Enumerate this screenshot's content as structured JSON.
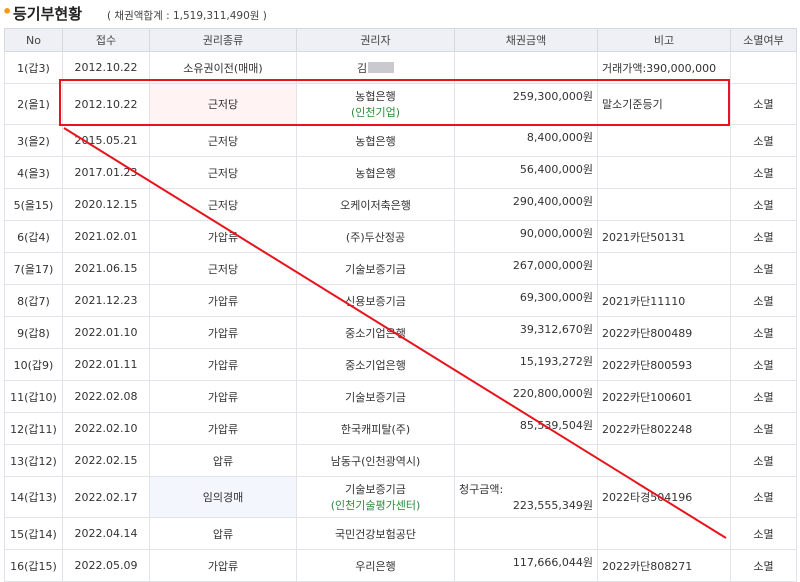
{
  "header": {
    "bullet": "•",
    "title": "등기부현황",
    "subtitle": "( 채권액합계 : 1,519,311,490원 )"
  },
  "columns": [
    "No",
    "접수",
    "권리종류",
    "권리자",
    "채권금액",
    "비고",
    "소멸여부"
  ],
  "rows": [
    {
      "no": "1(갑3)",
      "date": "2012.10.22",
      "type": "소유권이전(매매)",
      "holder": "김",
      "holder_sub": "",
      "amount": "",
      "note": "거래가액:390,000,000",
      "extinct": ""
    },
    {
      "no": "2(을1)",
      "date": "2012.10.22",
      "type": "근저당",
      "holder": "농협은행",
      "holder_sub": "(인천기업)",
      "amount": "259,300,000원",
      "note": "말소기준등기",
      "extinct": "소멸"
    },
    {
      "no": "3(을2)",
      "date": "2015.05.21",
      "type": "근저당",
      "holder": "농협은행",
      "holder_sub": "",
      "amount": "8,400,000원",
      "note": "",
      "extinct": "소멸"
    },
    {
      "no": "4(을3)",
      "date": "2017.01.23",
      "type": "근저당",
      "holder": "농협은행",
      "holder_sub": "",
      "amount": "56,400,000원",
      "note": "",
      "extinct": "소멸"
    },
    {
      "no": "5(을15)",
      "date": "2020.12.15",
      "type": "근저당",
      "holder": "오케이저축은행",
      "holder_sub": "",
      "amount": "290,400,000원",
      "note": "",
      "extinct": "소멸"
    },
    {
      "no": "6(갑4)",
      "date": "2021.02.01",
      "type": "가압류",
      "holder": "(주)두산정공",
      "holder_sub": "",
      "amount": "90,000,000원",
      "note": "2021카단50131",
      "extinct": "소멸"
    },
    {
      "no": "7(을17)",
      "date": "2021.06.15",
      "type": "근저당",
      "holder": "기술보증기금",
      "holder_sub": "",
      "amount": "267,000,000원",
      "note": "",
      "extinct": "소멸"
    },
    {
      "no": "8(갑7)",
      "date": "2021.12.23",
      "type": "가압류",
      "holder": "신용보증기금",
      "holder_sub": "",
      "amount": "69,300,000원",
      "note": "2021카단11110",
      "extinct": "소멸"
    },
    {
      "no": "9(갑8)",
      "date": "2022.01.10",
      "type": "가압류",
      "holder": "중소기업은행",
      "holder_sub": "",
      "amount": "39,312,670원",
      "note": "2022카단800489",
      "extinct": "소멸"
    },
    {
      "no": "10(갑9)",
      "date": "2022.01.11",
      "type": "가압류",
      "holder": "중소기업은행",
      "holder_sub": "",
      "amount": "15,193,272원",
      "note": "2022카단800593",
      "extinct": "소멸"
    },
    {
      "no": "11(갑10)",
      "date": "2022.02.08",
      "type": "가압류",
      "holder": "기술보증기금",
      "holder_sub": "",
      "amount": "220,800,000원",
      "note": "2022카단100601",
      "extinct": "소멸"
    },
    {
      "no": "12(갑11)",
      "date": "2022.02.10",
      "type": "가압류",
      "holder": "한국캐피탈(주)",
      "holder_sub": "",
      "amount": "85,539,504원",
      "note": "2022카단802248",
      "extinct": "소멸"
    },
    {
      "no": "13(갑12)",
      "date": "2022.02.15",
      "type": "압류",
      "holder": "남동구(인천광역시)",
      "holder_sub": "",
      "amount": "",
      "note": "",
      "extinct": "소멸"
    },
    {
      "no": "14(갑13)",
      "date": "2022.02.17",
      "type": "임의경매",
      "holder": "기술보증기금",
      "holder_sub": "(인천기술평가센터)",
      "amount_label": "청구금액:",
      "amount": "223,555,349원",
      "note": "2022타경504196",
      "extinct": "소멸"
    },
    {
      "no": "15(갑14)",
      "date": "2022.04.14",
      "type": "압류",
      "holder": "국민건강보험공단",
      "holder_sub": "",
      "amount": "",
      "note": "",
      "extinct": "소멸"
    },
    {
      "no": "16(갑15)",
      "date": "2022.05.09",
      "type": "가압류",
      "holder": "우리은행",
      "holder_sub": "",
      "amount": "117,666,044원",
      "note": "2022카단808271",
      "extinct": "소멸"
    }
  ],
  "highlight_color": "#e8141c"
}
